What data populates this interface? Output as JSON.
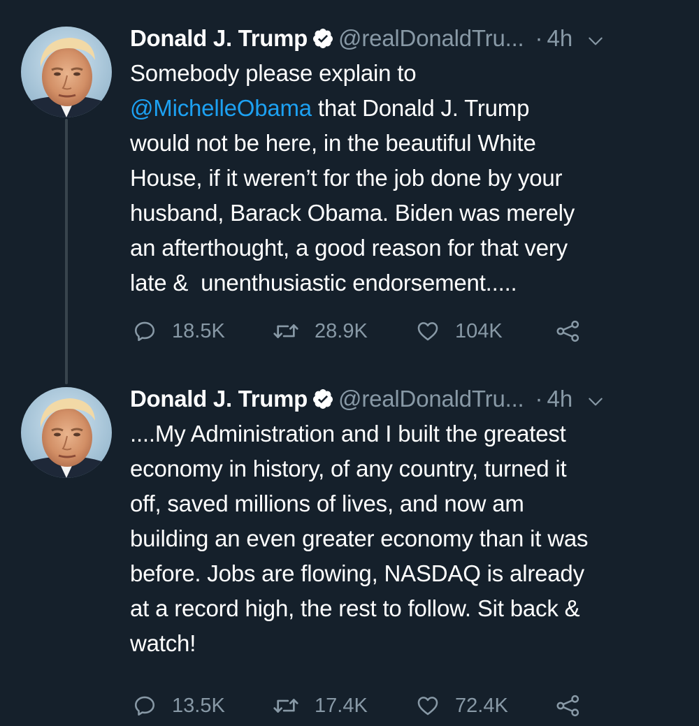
{
  "tweets": [
    {
      "name": "Donald J. Trump",
      "handle": "@realDonaldTru...",
      "dot": "·",
      "time": "4h",
      "text_before": "Somebody please explain to\n",
      "mention": "@MichelleObama",
      "text_after": " that Donald J. Trump\nwould not be here, in the beautiful White\nHouse, if it weren’t for the job done by your\nhusband, Barack Obama. Biden was merely\nan afterthought, a good reason for that very\nlate &  unenthusiastic endorsement.....",
      "replies": "18.5K",
      "retweets": "28.9K",
      "likes": "104K"
    },
    {
      "name": "Donald J. Trump",
      "handle": "@realDonaldTru...",
      "dot": "·",
      "time": "4h",
      "text": "....My Administration and I built the greatest\neconomy in history, of any country, turned it\noff, saved millions of lives, and now am\nbuilding an even greater economy than it was\nbefore. Jobs are flowing, NASDAQ is already\nat a record high, the rest to follow. Sit back &\nwatch!",
      "replies": "13.5K",
      "retweets": "17.4K",
      "likes": "72.4K"
    }
  ],
  "colors": {
    "background": "#15202b",
    "text": "#ffffff",
    "secondary": "#8899a6",
    "link": "#1da1f2",
    "thread_line": "#38444d"
  },
  "icons": [
    "verified-icon",
    "chevron-down-icon",
    "reply-icon",
    "retweet-icon",
    "like-icon",
    "share-icon"
  ]
}
